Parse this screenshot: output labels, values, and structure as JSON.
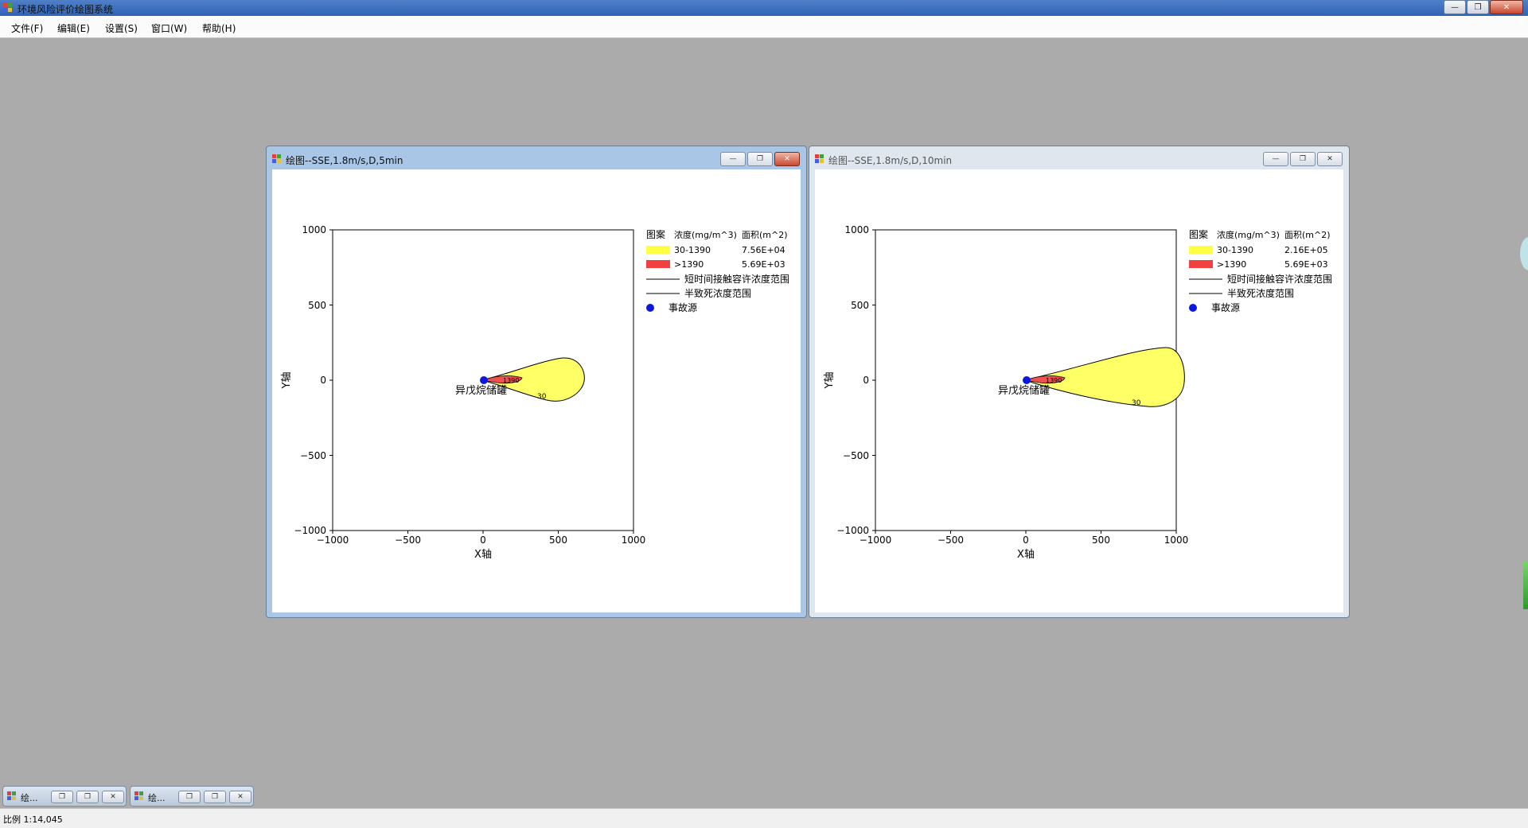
{
  "app": {
    "title": "环境风险评价绘图系统",
    "min_label": "—",
    "max_label": "❐",
    "close_label": "✕"
  },
  "menu": {
    "file": "文件(F)",
    "edit": "编辑(E)",
    "settings": "设置(S)",
    "window": "窗口(W)",
    "help": "帮助(H)"
  },
  "windows": [
    {
      "title": "绘图--SSE,1.8m/s,D,5min",
      "state": "active",
      "plot": {
        "ylabel": "Y轴",
        "xlabel": "X轴",
        "xticks": [
          "−1000",
          "−500",
          "0",
          "500",
          "1000"
        ],
        "yticks": [
          "1000",
          "500",
          "0",
          "−500",
          "−1000"
        ],
        "source_label": "异戊烷储罐",
        "contour_label_outer": "30",
        "contour_label_inner": "1390",
        "legend": {
          "header_pattern": "图案",
          "header_conc": "浓度(mg/m^3)",
          "header_area": "面积(m^2)",
          "rows": [
            {
              "conc": "30-1390",
              "area": "7.56E+04",
              "color": "#ffff44"
            },
            {
              "conc": ">1390",
              "area": "5.69E+03",
              "color": "#f04040"
            }
          ],
          "line1": "短时间接触容许浓度范围",
          "line2": "半致死浓度范围",
          "source": "事故源"
        }
      }
    },
    {
      "title": "绘图--SSE,1.8m/s,D,10min",
      "state": "inactive",
      "plot": {
        "ylabel": "Y轴",
        "xlabel": "X轴",
        "xticks": [
          "−1000",
          "−500",
          "0",
          "500",
          "1000"
        ],
        "yticks": [
          "1000",
          "500",
          "0",
          "−500",
          "−1000"
        ],
        "source_label": "异戊烷储罐",
        "contour_label_outer": "30",
        "contour_label_inner": "1390",
        "legend": {
          "header_pattern": "图案",
          "header_conc": "浓度(mg/m^3)",
          "header_area": "面积(m^2)",
          "rows": [
            {
              "conc": "30-1390",
              "area": "2.16E+05",
              "color": "#ffff44"
            },
            {
              "conc": ">1390",
              "area": "5.69E+03",
              "color": "#f04040"
            }
          ],
          "line1": "短时间接触容许浓度范围",
          "line2": "半致死浓度范围",
          "source": "事故源"
        }
      }
    }
  ],
  "minimized": [
    {
      "title": "绘..."
    },
    {
      "title": "绘..."
    }
  ],
  "status": {
    "scale": "比例 1:14,045"
  }
}
